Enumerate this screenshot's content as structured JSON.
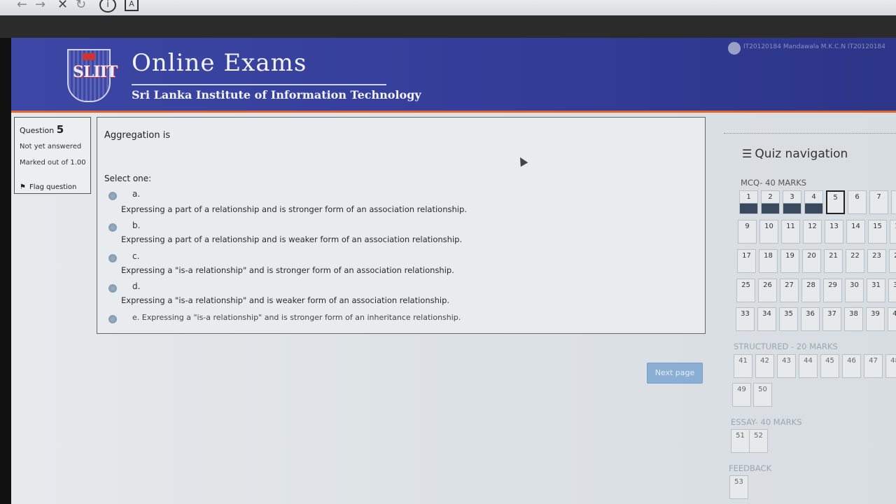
{
  "header": {
    "title": "Online Exams",
    "subtitle": "Sri Lanka Institute of Information Technology",
    "logo_text": "SLIIT",
    "user": "IT20120184 Mandawala M.K.C.N IT20120184"
  },
  "question_info": {
    "label": "Question",
    "number": "5",
    "status": "Not yet answered",
    "marked_out_of": "Marked out of 1.00",
    "flag": "Flag question"
  },
  "question": {
    "text": "Aggregation is",
    "select_label": "Select one:",
    "options": [
      {
        "letter": "a.",
        "text": "Expressing a part of a relationship and is stronger form of an association relationship."
      },
      {
        "letter": "b.",
        "text": "Expressing a part of a relationship and is weaker form of an association relationship."
      },
      {
        "letter": "c.",
        "text": "Expressing a \"is-a relationship\" and is stronger form of an association relationship."
      },
      {
        "letter": "d.",
        "text": "Expressing a \"is-a relationship\" and is weaker form of an association relationship."
      },
      {
        "letter": "",
        "text": "e. Expressing a \"is-a relationship\" and is stronger form of an inheritance relationship."
      }
    ],
    "next_button": "Next page"
  },
  "quiz_nav": {
    "title": "Quiz navigation",
    "sections": [
      {
        "label": "MCQ- 40 MARKS"
      },
      {
        "label": "STRUCTURED - 20 MARKS"
      },
      {
        "label": "ESSAY- 40 MARKS"
      },
      {
        "label": "FEEDBACK"
      }
    ],
    "answered": [
      1,
      2,
      3,
      4
    ],
    "current": 5
  },
  "colors": {
    "header_blue": "#3c46a4",
    "accent_orange": "#e8632b",
    "next_button": "#8aaed4"
  }
}
